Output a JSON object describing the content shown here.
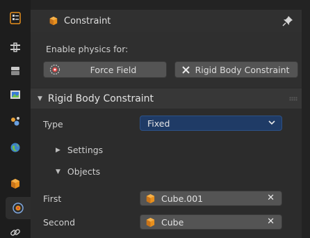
{
  "header": {
    "title": "Constraint",
    "title_icon": "constraint-cube-icon",
    "pin_icon": "pin-icon"
  },
  "tabs": [
    {
      "name": "tool-tab",
      "icon": "tool-icon"
    },
    {
      "name": "render-tab",
      "icon": "render-icon"
    },
    {
      "name": "output-tab",
      "icon": "output-icon"
    },
    {
      "name": "view-layer-tab",
      "icon": "image-icon"
    },
    {
      "name": "scene-tab",
      "icon": "scene-icon"
    },
    {
      "name": "world-tab",
      "icon": "world-icon"
    },
    {
      "name": "object-tab",
      "icon": "object-icon"
    },
    {
      "name": "physics-tab",
      "icon": "physics-icon",
      "active": true
    },
    {
      "name": "constraints-tab",
      "icon": "link-icon"
    }
  ],
  "enable_physics": {
    "label": "Enable physics for:",
    "force_field": "Force Field",
    "rigid_body_constraint": "Rigid Body Constraint"
  },
  "rbc_panel": {
    "title": "Rigid Body Constraint",
    "type_label": "Type",
    "type_value": "Fixed",
    "settings_label": "Settings",
    "objects_label": "Objects",
    "first_label": "First",
    "first_value": "Cube.001",
    "second_label": "Second",
    "second_value": "Cube"
  },
  "colors": {
    "accent_orange": "#e8901d",
    "dropdown_blue": "#1f3b66",
    "force_field_red": "#d84545"
  }
}
